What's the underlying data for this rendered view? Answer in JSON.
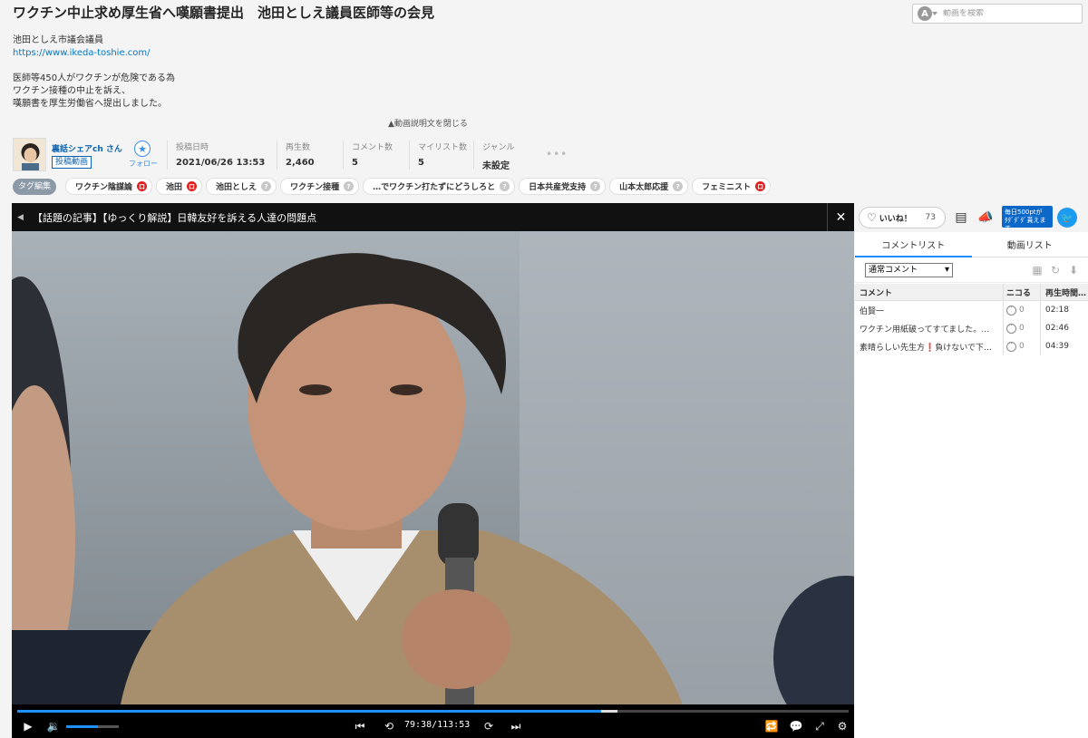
{
  "page": {
    "title": "ワクチン中止求め厚生省へ嘆願書提出　池田としえ議員医師等の会見"
  },
  "search": {
    "avatar_letter": "A",
    "placeholder": "動画を検索"
  },
  "description": {
    "line1": "池田としえ市議会議員",
    "link": "https://www.ikeda-toshie.com/",
    "line2": "医師等450人がワクチンが危険である為",
    "line3": "ワクチン接種の中止を訴え、",
    "line4": "嘆願書を厚生労働省へ提出しました。",
    "toggle": "▲動画説明文を閉じる"
  },
  "uploader": {
    "name": "裏話シェアch さん",
    "badge": "投稿動画",
    "follow_label": "フォロー"
  },
  "stats": [
    {
      "label": "投稿日時",
      "value": "2021/06/26 13:53"
    },
    {
      "label": "再生数",
      "value": "2,460"
    },
    {
      "label": "コメント数",
      "value": "5"
    },
    {
      "label": "マイリスト数",
      "value": "5"
    },
    {
      "label": "ジャンル",
      "value": "未設定"
    }
  ],
  "more": "•••",
  "tags": {
    "edit_label": "タグ編集",
    "items": [
      {
        "label": "ワクチン陰謀論",
        "badge": "lock"
      },
      {
        "label": "池田",
        "badge": "lock"
      },
      {
        "label": "池田としえ",
        "badge": "q"
      },
      {
        "label": "ワクチン接種",
        "badge": "q"
      },
      {
        "label": "…でワクチン打たずにどうしろと",
        "badge": "q"
      },
      {
        "label": "日本共産党支持",
        "badge": "q"
      },
      {
        "label": "山本太郎応援",
        "badge": "q"
      },
      {
        "label": "フェミニスト",
        "badge": "lock"
      }
    ]
  },
  "player": {
    "ticker_text": "【話題の記事】【ゆっくり解説】日韓友好を訴える人達の問題点",
    "close_icon": "✕",
    "time": "79:38/113:53",
    "progress_fraction": 0.702,
    "volume_fraction": 0.6
  },
  "panel": {
    "like_label": "いいね！",
    "like_count": "73",
    "promo_line1": "毎日500ptが",
    "promo_line2": "ﾀﾀﾞﾀﾞﾀﾞ貰えます",
    "tabs": [
      {
        "label": "コメントリスト",
        "active": true
      },
      {
        "label": "動画リスト",
        "active": false
      }
    ],
    "select_value": "通常コメント",
    "columns": [
      "コメント",
      "ニコる",
      "再生時間…"
    ],
    "comments": [
      {
        "text": "伯賢一",
        "nico": "0",
        "time": "02:18"
      },
      {
        "text": "ワクチン用紙破ってすてました。お…",
        "nico": "0",
        "time": "02:46"
      },
      {
        "text": "素晴らしい先生方❗負けないで下さ…",
        "nico": "0",
        "time": "04:39"
      }
    ]
  }
}
